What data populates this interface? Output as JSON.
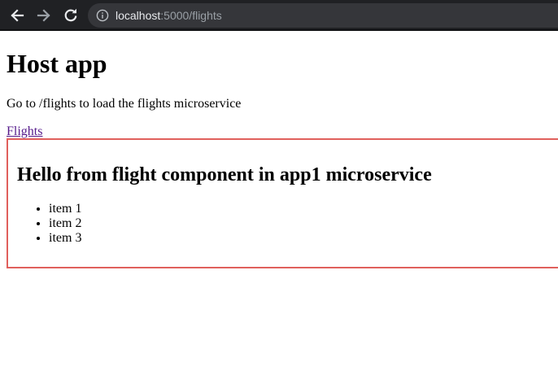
{
  "browser": {
    "url_host": "localhost",
    "url_rest": ":5000/flights"
  },
  "page": {
    "title": "Host app",
    "intro": "Go to /flights to load the flights microservice",
    "link_label": "Flights"
  },
  "microfrontend": {
    "heading": "Hello from flight component in app1 microservice",
    "items": [
      "item 1",
      "item 2",
      "item 3"
    ],
    "border_color": "#e0605c"
  },
  "colors": {
    "toolbar_bg": "#202124",
    "omnibox_bg": "#35363a",
    "visited_link": "#551a8b"
  },
  "icons": {
    "back": "arrow-left",
    "forward": "arrow-right",
    "reload": "reload",
    "site_info": "info-circle"
  }
}
